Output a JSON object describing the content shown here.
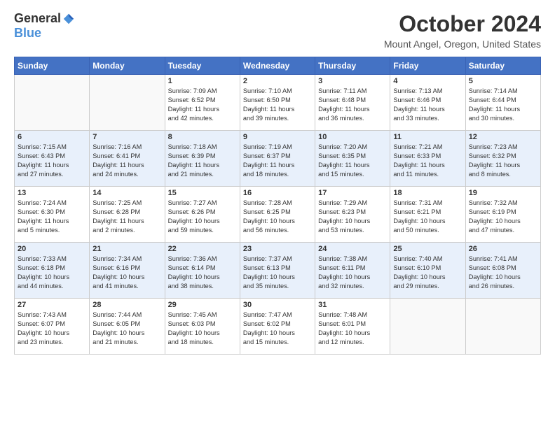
{
  "header": {
    "logo_general": "General",
    "logo_blue": "Blue",
    "title": "October 2024",
    "location": "Mount Angel, Oregon, United States"
  },
  "columns": [
    "Sunday",
    "Monday",
    "Tuesday",
    "Wednesday",
    "Thursday",
    "Friday",
    "Saturday"
  ],
  "weeks": [
    [
      {
        "day": "",
        "lines": []
      },
      {
        "day": "",
        "lines": []
      },
      {
        "day": "1",
        "lines": [
          "Sunrise: 7:09 AM",
          "Sunset: 6:52 PM",
          "Daylight: 11 hours",
          "and 42 minutes."
        ]
      },
      {
        "day": "2",
        "lines": [
          "Sunrise: 7:10 AM",
          "Sunset: 6:50 PM",
          "Daylight: 11 hours",
          "and 39 minutes."
        ]
      },
      {
        "day": "3",
        "lines": [
          "Sunrise: 7:11 AM",
          "Sunset: 6:48 PM",
          "Daylight: 11 hours",
          "and 36 minutes."
        ]
      },
      {
        "day": "4",
        "lines": [
          "Sunrise: 7:13 AM",
          "Sunset: 6:46 PM",
          "Daylight: 11 hours",
          "and 33 minutes."
        ]
      },
      {
        "day": "5",
        "lines": [
          "Sunrise: 7:14 AM",
          "Sunset: 6:44 PM",
          "Daylight: 11 hours",
          "and 30 minutes."
        ]
      }
    ],
    [
      {
        "day": "6",
        "lines": [
          "Sunrise: 7:15 AM",
          "Sunset: 6:43 PM",
          "Daylight: 11 hours",
          "and 27 minutes."
        ]
      },
      {
        "day": "7",
        "lines": [
          "Sunrise: 7:16 AM",
          "Sunset: 6:41 PM",
          "Daylight: 11 hours",
          "and 24 minutes."
        ]
      },
      {
        "day": "8",
        "lines": [
          "Sunrise: 7:18 AM",
          "Sunset: 6:39 PM",
          "Daylight: 11 hours",
          "and 21 minutes."
        ]
      },
      {
        "day": "9",
        "lines": [
          "Sunrise: 7:19 AM",
          "Sunset: 6:37 PM",
          "Daylight: 11 hours",
          "and 18 minutes."
        ]
      },
      {
        "day": "10",
        "lines": [
          "Sunrise: 7:20 AM",
          "Sunset: 6:35 PM",
          "Daylight: 11 hours",
          "and 15 minutes."
        ]
      },
      {
        "day": "11",
        "lines": [
          "Sunrise: 7:21 AM",
          "Sunset: 6:33 PM",
          "Daylight: 11 hours",
          "and 11 minutes."
        ]
      },
      {
        "day": "12",
        "lines": [
          "Sunrise: 7:23 AM",
          "Sunset: 6:32 PM",
          "Daylight: 11 hours",
          "and 8 minutes."
        ]
      }
    ],
    [
      {
        "day": "13",
        "lines": [
          "Sunrise: 7:24 AM",
          "Sunset: 6:30 PM",
          "Daylight: 11 hours",
          "and 5 minutes."
        ]
      },
      {
        "day": "14",
        "lines": [
          "Sunrise: 7:25 AM",
          "Sunset: 6:28 PM",
          "Daylight: 11 hours",
          "and 2 minutes."
        ]
      },
      {
        "day": "15",
        "lines": [
          "Sunrise: 7:27 AM",
          "Sunset: 6:26 PM",
          "Daylight: 10 hours",
          "and 59 minutes."
        ]
      },
      {
        "day": "16",
        "lines": [
          "Sunrise: 7:28 AM",
          "Sunset: 6:25 PM",
          "Daylight: 10 hours",
          "and 56 minutes."
        ]
      },
      {
        "day": "17",
        "lines": [
          "Sunrise: 7:29 AM",
          "Sunset: 6:23 PM",
          "Daylight: 10 hours",
          "and 53 minutes."
        ]
      },
      {
        "day": "18",
        "lines": [
          "Sunrise: 7:31 AM",
          "Sunset: 6:21 PM",
          "Daylight: 10 hours",
          "and 50 minutes."
        ]
      },
      {
        "day": "19",
        "lines": [
          "Sunrise: 7:32 AM",
          "Sunset: 6:19 PM",
          "Daylight: 10 hours",
          "and 47 minutes."
        ]
      }
    ],
    [
      {
        "day": "20",
        "lines": [
          "Sunrise: 7:33 AM",
          "Sunset: 6:18 PM",
          "Daylight: 10 hours",
          "and 44 minutes."
        ]
      },
      {
        "day": "21",
        "lines": [
          "Sunrise: 7:34 AM",
          "Sunset: 6:16 PM",
          "Daylight: 10 hours",
          "and 41 minutes."
        ]
      },
      {
        "day": "22",
        "lines": [
          "Sunrise: 7:36 AM",
          "Sunset: 6:14 PM",
          "Daylight: 10 hours",
          "and 38 minutes."
        ]
      },
      {
        "day": "23",
        "lines": [
          "Sunrise: 7:37 AM",
          "Sunset: 6:13 PM",
          "Daylight: 10 hours",
          "and 35 minutes."
        ]
      },
      {
        "day": "24",
        "lines": [
          "Sunrise: 7:38 AM",
          "Sunset: 6:11 PM",
          "Daylight: 10 hours",
          "and 32 minutes."
        ]
      },
      {
        "day": "25",
        "lines": [
          "Sunrise: 7:40 AM",
          "Sunset: 6:10 PM",
          "Daylight: 10 hours",
          "and 29 minutes."
        ]
      },
      {
        "day": "26",
        "lines": [
          "Sunrise: 7:41 AM",
          "Sunset: 6:08 PM",
          "Daylight: 10 hours",
          "and 26 minutes."
        ]
      }
    ],
    [
      {
        "day": "27",
        "lines": [
          "Sunrise: 7:43 AM",
          "Sunset: 6:07 PM",
          "Daylight: 10 hours",
          "and 23 minutes."
        ]
      },
      {
        "day": "28",
        "lines": [
          "Sunrise: 7:44 AM",
          "Sunset: 6:05 PM",
          "Daylight: 10 hours",
          "and 21 minutes."
        ]
      },
      {
        "day": "29",
        "lines": [
          "Sunrise: 7:45 AM",
          "Sunset: 6:03 PM",
          "Daylight: 10 hours",
          "and 18 minutes."
        ]
      },
      {
        "day": "30",
        "lines": [
          "Sunrise: 7:47 AM",
          "Sunset: 6:02 PM",
          "Daylight: 10 hours",
          "and 15 minutes."
        ]
      },
      {
        "day": "31",
        "lines": [
          "Sunrise: 7:48 AM",
          "Sunset: 6:01 PM",
          "Daylight: 10 hours",
          "and 12 minutes."
        ]
      },
      {
        "day": "",
        "lines": []
      },
      {
        "day": "",
        "lines": []
      }
    ]
  ]
}
